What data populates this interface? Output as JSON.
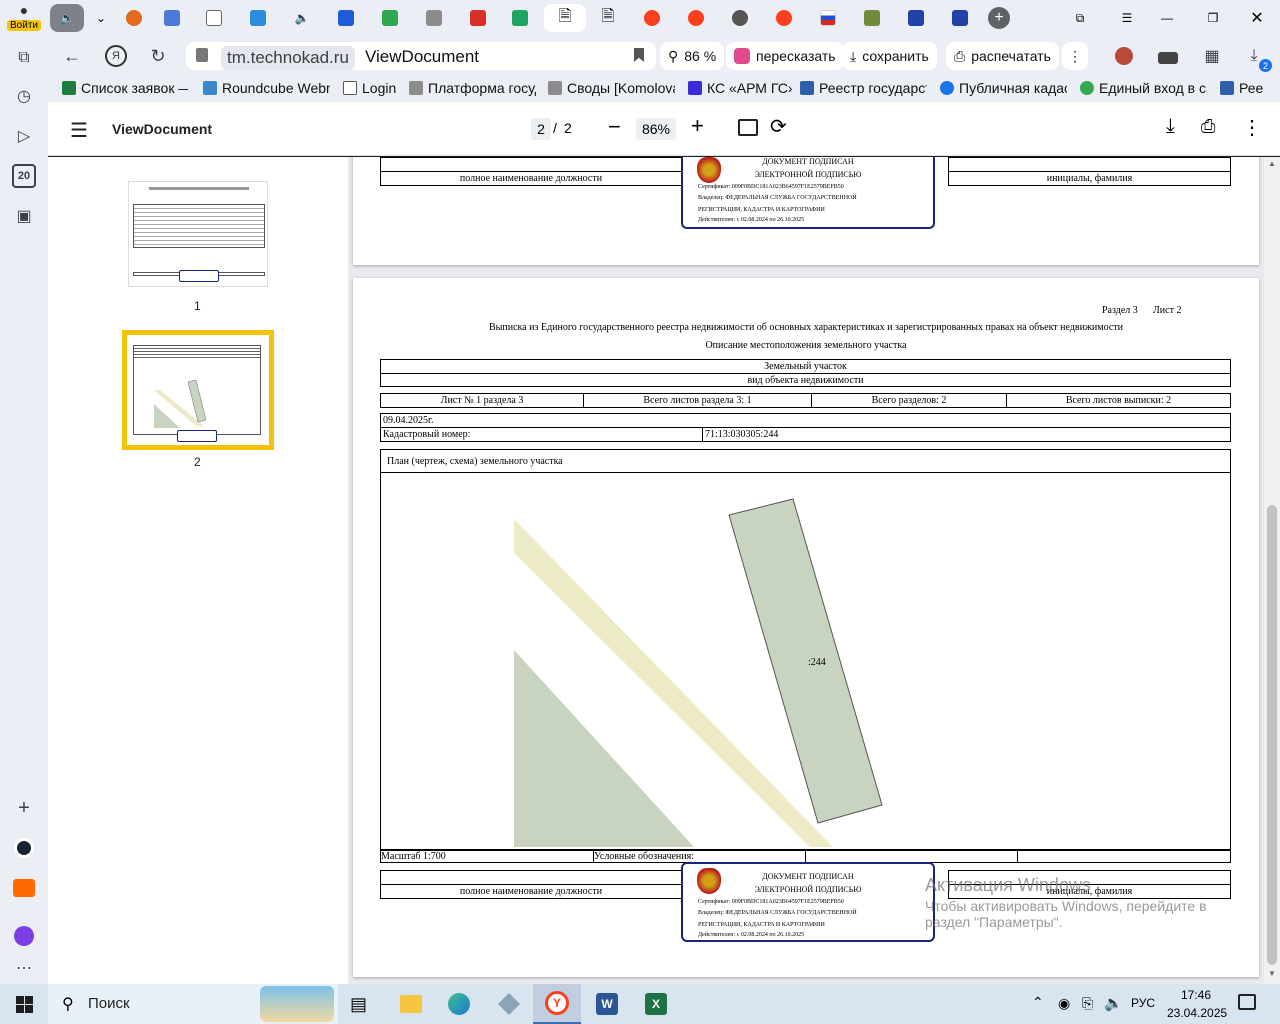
{
  "sidebar": {
    "login_label": "Войти",
    "badge": "20"
  },
  "tabs": {
    "active_index": 10
  },
  "address": {
    "domain": "tm.technokad.ru",
    "title": "ViewDocument"
  },
  "actions": {
    "zoom": "86 %",
    "retell": "пересказать",
    "save": "сохранить",
    "print": "распечатать",
    "downloads_badge": "2"
  },
  "bookmarks": [
    "Список заявок —",
    "Roundcube Webm",
    "Login",
    "Платформа госуд",
    "Своды [Komolova",
    "КС «АРМ ГС»",
    "Реестр государст",
    "Публичная кадаст",
    "Единый вход в си",
    "Рее"
  ],
  "pdf": {
    "title": "ViewDocument",
    "page_current": "2",
    "page_sep": "/",
    "page_total": "2",
    "zoom": "86%"
  },
  "thumbs": [
    {
      "label": "1"
    },
    {
      "label": "2"
    }
  ],
  "page1_tail": {
    "position_label": "полное наименование должности",
    "initials_label": "инициалы, фамилия"
  },
  "signature": {
    "line1": "ДОКУМЕНТ ПОДПИСАН",
    "line2": "ЭЛЕКТРОННОЙ ПОДПИСЬЮ",
    "cert": "Сертификат: 009F0BDC181A023B64597F1E2579BEFB50",
    "owner1": "Владелец: ФЕДЕРАЛЬНАЯ СЛУЖБА ГОСУДАРСТВЕННОЙ",
    "owner2": "РЕГИСТРАЦИИ, КАДАСТРА И КАРТОГРАФИИ",
    "valid": "Действителен: с 02.08.2024 по 26.10.2025"
  },
  "page2": {
    "section": "Раздел 3",
    "sheet": "Лист 2",
    "heading": "Выписка из Единого государственного реестра недвижимости об основных характеристиках и зарегистрированных правах на объект недвижимости",
    "subheading": "Описание местоположения земельного участка",
    "object": "Земельный участок",
    "object_caption": "вид объекта недвижимости",
    "sheet_no": "Лист № 1 раздела 3",
    "sheets_in_section": "Всего листов раздела 3: 1",
    "sections_total": "Всего разделов: 2",
    "sheets_total": "Всего листов выписки: 2",
    "date": "09.04.2025г.",
    "cadastral_label": "Кадастровый номер:",
    "cadastral_value": "71:13:030305:244",
    "plan_title": "План (чертеж, схема) земельного участка",
    "parcel_label": ":244",
    "scale": "Масштаб 1:700",
    "legend": "Условные обозначения:",
    "position_label": "полное наименование должности",
    "initials_label": "инициалы, фамилия"
  },
  "watermark": {
    "line1": "Активация Windows",
    "line2": "Чтобы активировать Windows, перейдите в",
    "line3": "раздел \"Параметры\"."
  },
  "taskbar": {
    "search": "Поиск",
    "lang": "РУС",
    "time": "17:46",
    "date": "23.04.2025"
  }
}
